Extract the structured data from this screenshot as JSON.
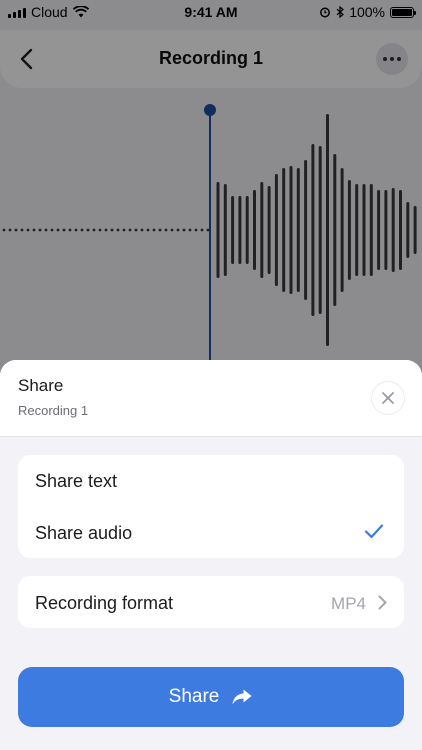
{
  "status": {
    "carrier": "Cloud",
    "time": "9:41 AM",
    "battery": "100%",
    "battery_level": 1.0
  },
  "nav": {
    "title": "Recording 1",
    "back_icon": "chevron-left-icon",
    "more_icon": "ellipsis-icon"
  },
  "sheet": {
    "title": "Share",
    "subtitle": "Recording 1",
    "close_icon": "close-icon",
    "options": [
      {
        "label": "Share text",
        "selected": false
      },
      {
        "label": "Share audio",
        "selected": true
      }
    ],
    "format": {
      "label": "Recording format",
      "value": "MP4"
    },
    "share_button": {
      "label": "Share",
      "icon": "share-arrow-icon"
    }
  },
  "colors": {
    "accent": "#3e7be0",
    "playhead": "#1f4fa0",
    "waveform": "#3a3a3f"
  }
}
